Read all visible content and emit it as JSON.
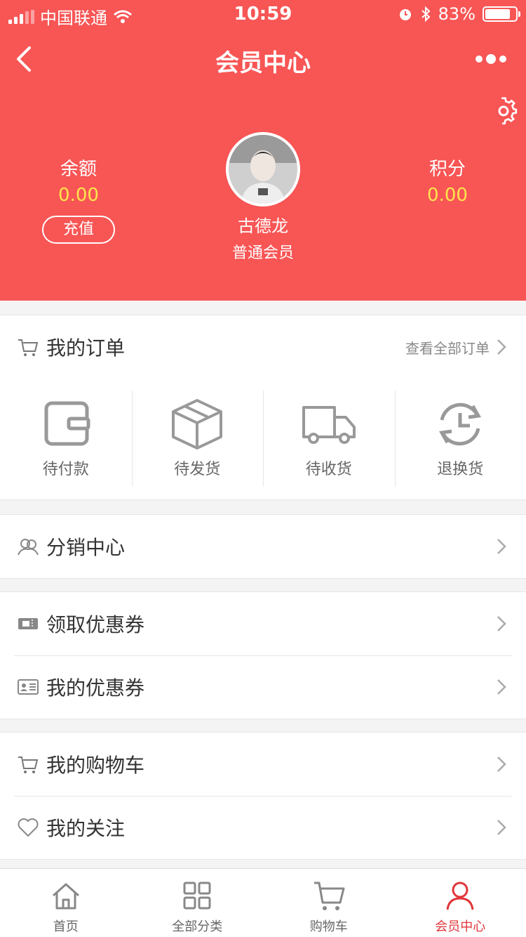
{
  "status_bar": {
    "carrier": "中国联通",
    "time": "10:59",
    "battery": "83%"
  },
  "nav": {
    "title": "会员中心"
  },
  "member": {
    "balance_label": "余额",
    "balance_value": "0.00",
    "recharge_label": "充值",
    "points_label": "积分",
    "points_value": "0.00",
    "name": "古德龙",
    "level": "普通会员"
  },
  "orders": {
    "title": "我的订单",
    "view_all": "查看全部订单",
    "items": [
      {
        "label": "待付款",
        "icon": "wallet-icon"
      },
      {
        "label": "待发货",
        "icon": "box-icon"
      },
      {
        "label": "待收货",
        "icon": "truck-icon"
      },
      {
        "label": "退换货",
        "icon": "refresh-icon"
      }
    ]
  },
  "menu": {
    "distribution": "分销中心",
    "get_coupons": "领取优惠券",
    "my_coupons": "我的优惠券",
    "my_cart": "我的购物车",
    "my_follows": "我的关注"
  },
  "tabbar": {
    "items": [
      {
        "label": "首页",
        "icon": "home-icon"
      },
      {
        "label": "全部分类",
        "icon": "grid-icon"
      },
      {
        "label": "购物车",
        "icon": "cart-icon"
      },
      {
        "label": "会员中心",
        "icon": "user-icon"
      }
    ],
    "active_color": "#e0363a"
  },
  "colors": {
    "header": "#f85555",
    "value": "#ffe44d"
  }
}
